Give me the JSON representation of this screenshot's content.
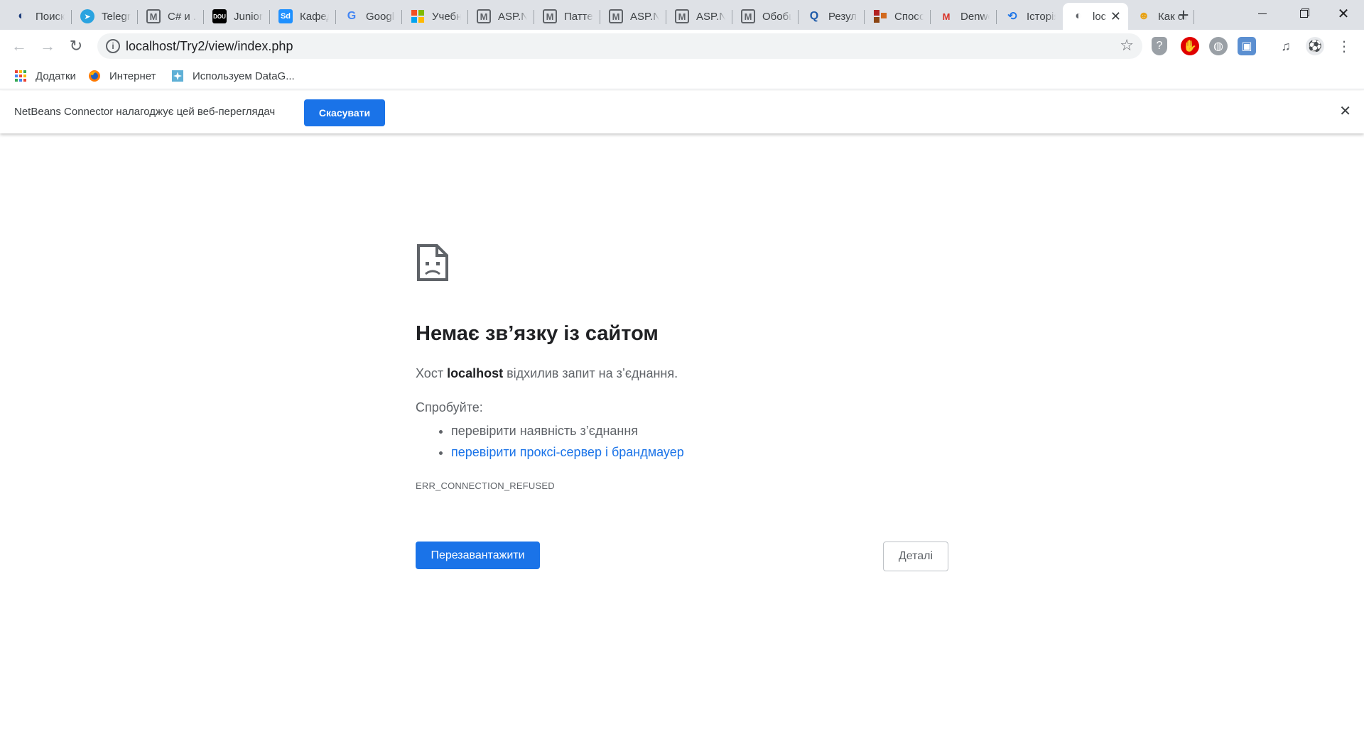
{
  "tabs": [
    {
      "label": "Поиск",
      "icon": "globe-icon",
      "color": "#1a3a7a"
    },
    {
      "label": "Telegram",
      "icon": "telegram-icon",
      "color": "#2aa3e0"
    },
    {
      "label": "C# и .N",
      "icon": "metanit-icon",
      "color": "#5f6368"
    },
    {
      "label": "Junior",
      "icon": "dou-icon",
      "color": "#000000"
    },
    {
      "label": "Кафедра",
      "icon": "sd-icon",
      "color": "#1e90ff"
    },
    {
      "label": "Google",
      "icon": "google-translate-icon",
      "color": "#4285f4"
    },
    {
      "label": "Учебник",
      "icon": "microsoft-icon",
      "color": "#f25022"
    },
    {
      "label": "ASP.NET",
      "icon": "metanit-icon",
      "color": "#5f6368"
    },
    {
      "label": "Паттерн",
      "icon": "metanit-icon",
      "color": "#5f6368"
    },
    {
      "label": "ASP.NET",
      "icon": "metanit-icon",
      "color": "#5f6368"
    },
    {
      "label": "ASP.NET",
      "icon": "metanit-icon",
      "color": "#5f6368"
    },
    {
      "label": "Обобщ",
      "icon": "metanit-icon",
      "color": "#5f6368"
    },
    {
      "label": "Результ",
      "icon": "q-icon",
      "color": "#1e5aa8"
    },
    {
      "label": "Способ",
      "icon": "blocks-icon",
      "color": "#b22222"
    },
    {
      "label": "Denwer",
      "icon": "gmail-icon",
      "color": "#d93025"
    },
    {
      "label": "Історія",
      "icon": "history-icon",
      "color": "#1a73e8"
    },
    {
      "label": "loc",
      "icon": "globe-icon",
      "color": "#5f6368",
      "active": true
    },
    {
      "label": "Как от",
      "icon": "people-icon",
      "color": "#e8a317"
    }
  ],
  "toolbar": {
    "url": "localhost/Try2/view/index.php"
  },
  "bookmarks": [
    {
      "label": "Додатки",
      "icon": "apps-grid-icon"
    },
    {
      "label": "Интернет",
      "icon": "firefox-icon"
    },
    {
      "label": "Используем DataG...",
      "icon": "datagrip-icon"
    }
  ],
  "infobar": {
    "message": "NetBeans Connector налагоджує цей веб-переглядач",
    "cancel_label": "Скасувати"
  },
  "error": {
    "title": "Немає зв’язку із сайтом",
    "desc_prefix": "Хост ",
    "host": "localhost",
    "desc_suffix": " відхилив запит на з’єднання.",
    "try_label": "Спробуйте:",
    "suggestions": [
      {
        "text": "перевірити наявність з’єднання",
        "link": false
      },
      {
        "text": "перевірити проксі-сервер і брандмауер",
        "link": true
      }
    ],
    "code": "ERR_CONNECTION_REFUSED",
    "reload_label": "Перезавантажити",
    "details_label": "Деталі"
  },
  "colors": {
    "accent": "#1a73e8",
    "tabstrip": "#dee1e6",
    "omnibox": "#f1f3f4"
  }
}
